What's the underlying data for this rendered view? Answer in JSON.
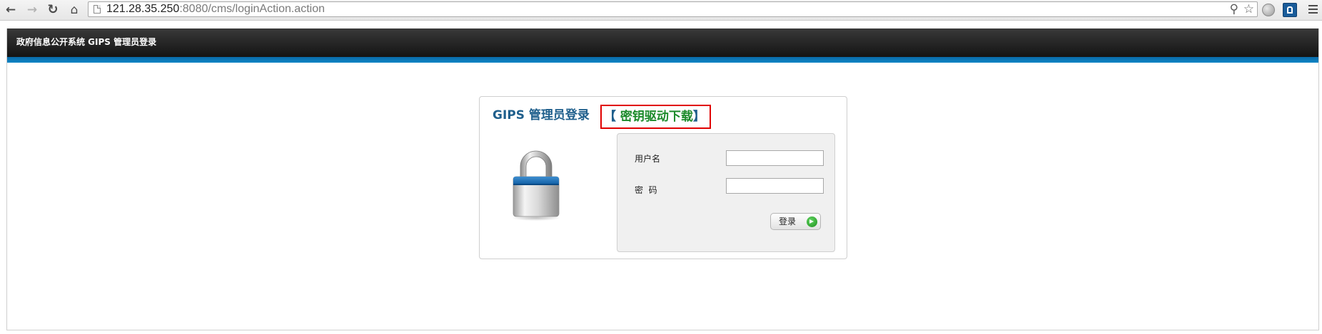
{
  "browser": {
    "url_host": "121.28.35.250",
    "url_rest": ":8080/cms/loginAction.action"
  },
  "header": {
    "title": "政府信息公开系统 GIPS 管理员登录"
  },
  "login": {
    "title": "GIPS 管理员登录",
    "download_open": "【 ",
    "download_label": "密钥驱动下载",
    "download_close": "】",
    "username_label": "用户名",
    "username_value": "",
    "password_label": "密  码",
    "password_value": "",
    "submit_label": "登录"
  },
  "icons": {
    "back": "back-arrow-icon",
    "forward": "forward-arrow-icon",
    "reload": "reload-icon",
    "home": "home-icon",
    "page": "page-icon",
    "zoom": "zoom-icon",
    "bookmark": "star-icon",
    "lock": "padlock-icon",
    "go": "go-arrow-icon",
    "menu": "menu-icon"
  },
  "colors": {
    "header_bg": "#1a1a1a",
    "header_accent": "#0e7cba",
    "title_blue": "#1f5f8c",
    "download_green": "#1c8a2a",
    "highlight_red": "#e00000"
  }
}
